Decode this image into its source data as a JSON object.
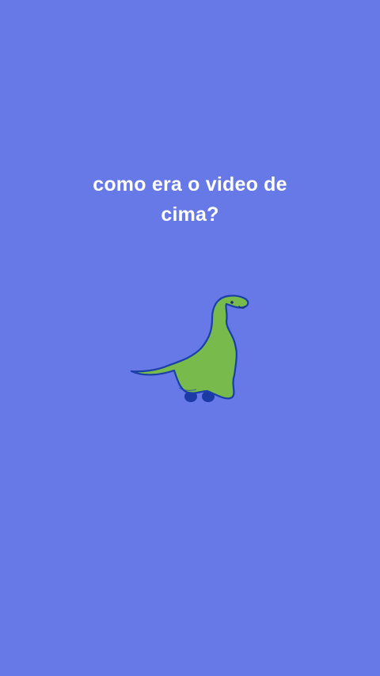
{
  "caption": {
    "text": "como era o video de cima?"
  },
  "illustration": {
    "name": "dinosaur",
    "body_color": "#78bb4c",
    "outline_color": "#1a3fa8",
    "feet_color": "#1c3aa5"
  },
  "colors": {
    "background": "#6679e6",
    "text": "#ffffff"
  }
}
